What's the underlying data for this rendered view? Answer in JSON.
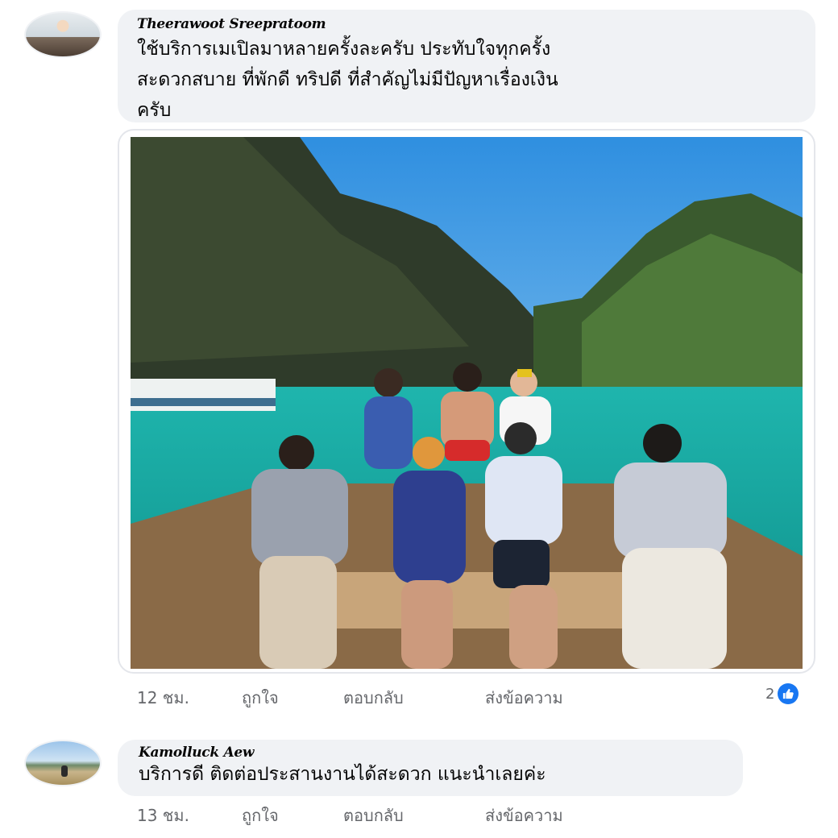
{
  "comments": [
    {
      "author": "Theerawoot Sreepratoom",
      "text_lines": [
        "ใช้บริการเมเปิลมาหลายครั้งละครับ ประทับใจทุกครั้ง",
        "สะดวกสบาย ที่พักดี ทริปดี ที่สำคัญไม่มีปัญหาเรื่องเงิน",
        "ครับ"
      ],
      "time": "12 ชม.",
      "like_label": "ถูกใจ",
      "reply_label": "ตอบกลับ",
      "message_label": "ส่งข้อความ",
      "reaction_count": "2",
      "reaction_icon": "like-thumb-icon",
      "has_photo": true
    },
    {
      "author": "Kamolluck Aew",
      "text_lines": [
        "บริการดี ติดต่อประสานงานได้สะดวก แนะนำเลยค่ะ"
      ],
      "time": "13 ชม.",
      "like_label": "ถูกใจ",
      "reply_label": "ตอบกลับ",
      "message_label": "ส่งข้อความ"
    }
  ],
  "colors": {
    "bubble": "#f0f2f5",
    "secondary_text": "#65676b",
    "like_blue": "#1877f2"
  }
}
